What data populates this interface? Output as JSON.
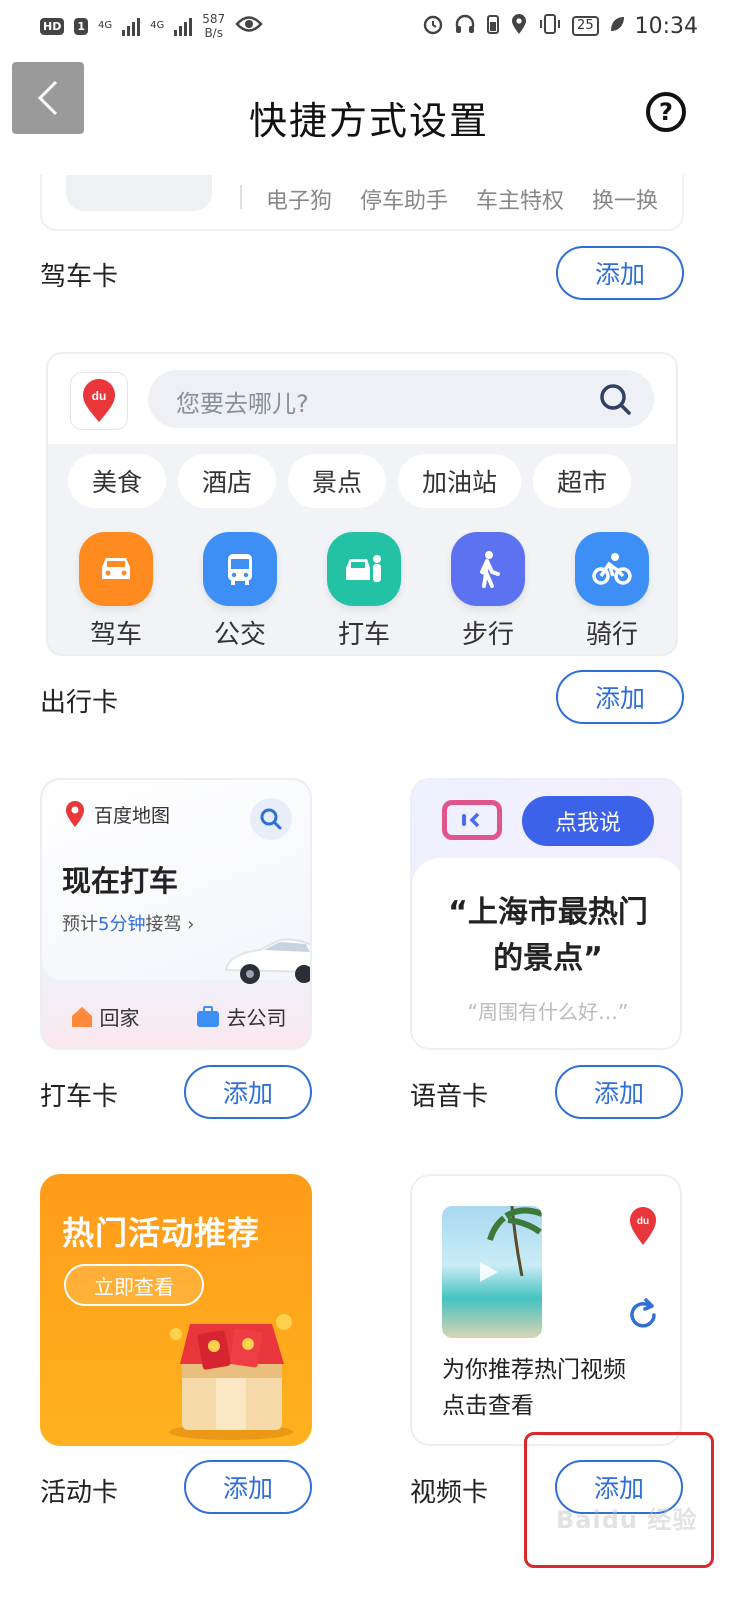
{
  "status_bar": {
    "hd_label": "HD",
    "sim1_label": "1",
    "network1": "4G",
    "network2": "4G",
    "speed_value": "587",
    "speed_unit": "B/s",
    "battery": "25",
    "time": "10:34"
  },
  "header": {
    "title": "快捷方式设置",
    "help_glyph": "?"
  },
  "drive_card": {
    "links": [
      "电子狗",
      "停车助手",
      "车主特权",
      "换一换"
    ],
    "label": "驾车卡",
    "add_label": "添加"
  },
  "travel_card": {
    "search_placeholder": "您要去哪儿?",
    "logo_text": "du",
    "chips": [
      "美食",
      "酒店",
      "景点",
      "加油站",
      "超市"
    ],
    "modes": [
      {
        "label": "驾车",
        "icon": "car-icon",
        "color": "#ff8a1f"
      },
      {
        "label": "公交",
        "icon": "bus-icon",
        "color": "#3d8ef5"
      },
      {
        "label": "打车",
        "icon": "taxi-icon",
        "color": "#23c2a5"
      },
      {
        "label": "步行",
        "icon": "walk-icon",
        "color": "#5d72f0"
      },
      {
        "label": "骑行",
        "icon": "bike-icon",
        "color": "#3d8ef5"
      }
    ],
    "label": "出行卡",
    "add_label": "添加"
  },
  "taxi_card": {
    "brand": "百度地图",
    "title": "现在打车",
    "sub_prefix": "预计",
    "sub_highlight": "5分钟",
    "sub_suffix": "接驾 ›",
    "home_label": "回家",
    "work_label": "去公司",
    "label": "打车卡",
    "add_label": "添加"
  },
  "voice_card": {
    "button_label": "点我说",
    "quote_line1": "“上海市最热门",
    "quote_line2": "的景点”",
    "hint": "“周围有什么好…”",
    "label": "语音卡",
    "add_label": "添加"
  },
  "activity_card": {
    "title": "热门活动推荐",
    "button_label": "立即查看",
    "label": "活动卡",
    "add_label": "添加"
  },
  "video_card": {
    "line1": "为你推荐热门视频",
    "line2": "点击查看",
    "pin_text": "du",
    "label": "视频卡",
    "add_label": "添加"
  },
  "watermark": "Baidu 经验",
  "colors": {
    "accent": "#2f6fd6",
    "highlight_border": "#d8292c"
  }
}
